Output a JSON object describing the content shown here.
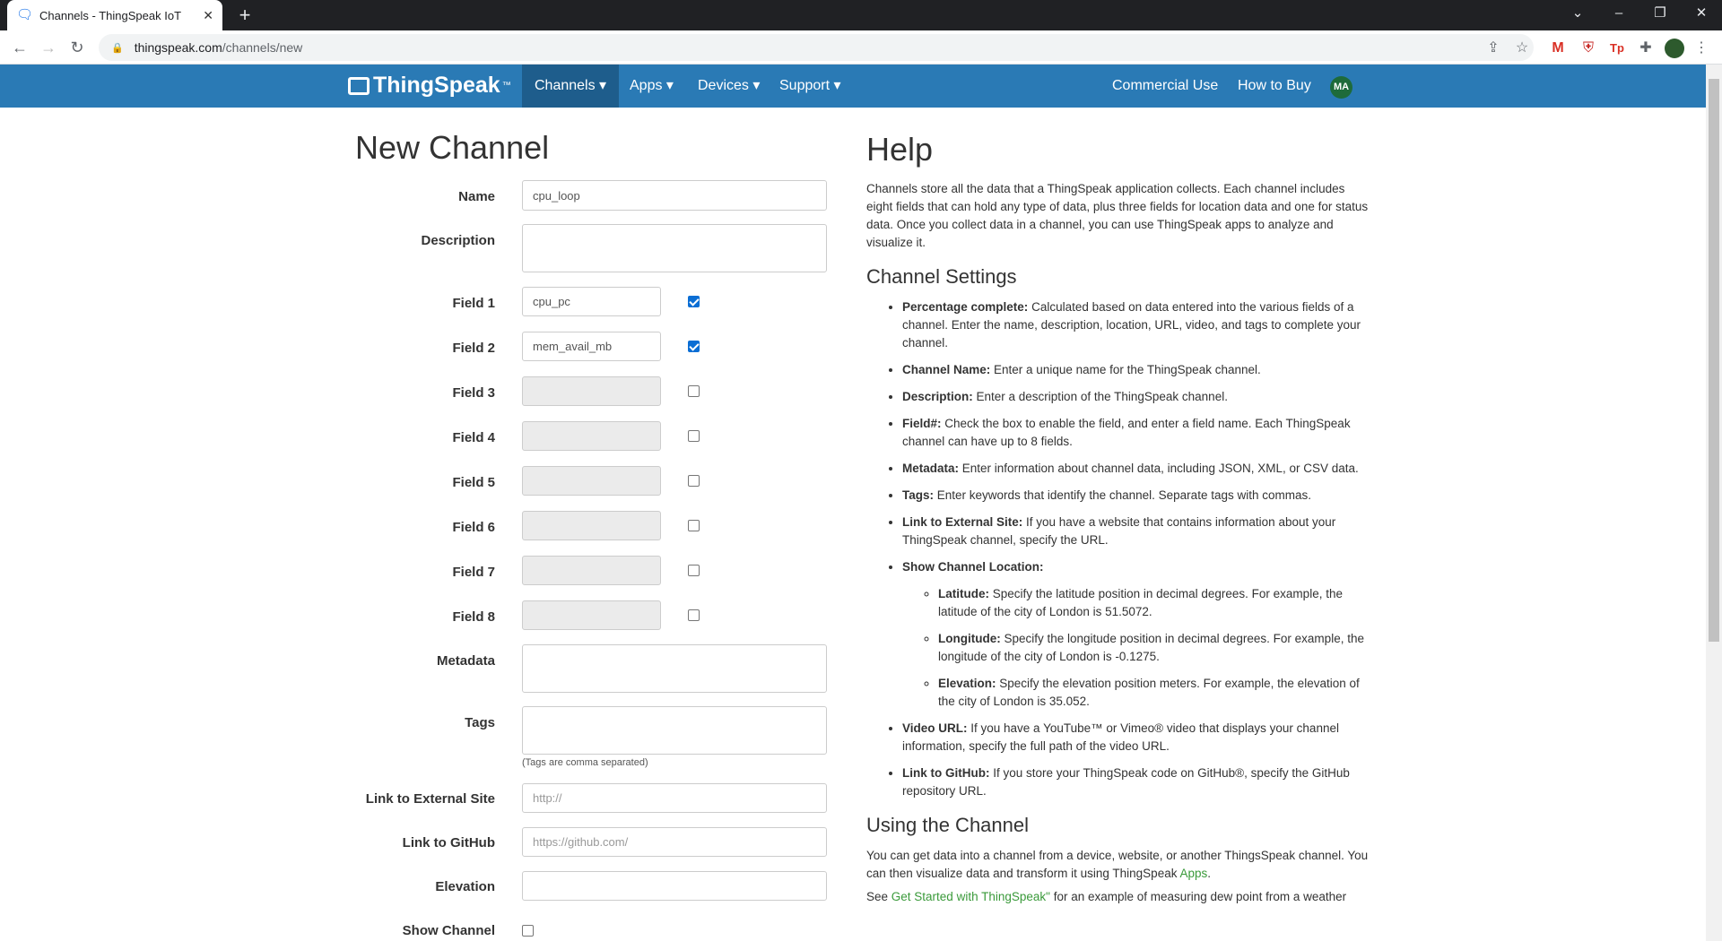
{
  "browser": {
    "tab_title": "Channels - ThingSpeak IoT",
    "url_host": "thingspeak.com",
    "url_path": "/channels/new"
  },
  "nav": {
    "logo": "ThingSpeak",
    "logo_tm": "™",
    "channels": "Channels ▾",
    "apps": "Apps ▾",
    "devices": "Devices ▾",
    "support": "Support ▾",
    "commercial": "Commercial Use",
    "how_to_buy": "How to Buy",
    "avatar": "MA"
  },
  "form": {
    "title": "New Channel",
    "name_label": "Name",
    "name_value": "cpu_loop",
    "description_label": "Description",
    "fields": [
      {
        "label": "Field 1",
        "value": "cpu_pc",
        "checked": true
      },
      {
        "label": "Field 2",
        "value": "mem_avail_mb",
        "checked": true
      },
      {
        "label": "Field 3",
        "value": "",
        "checked": false
      },
      {
        "label": "Field 4",
        "value": "",
        "checked": false
      },
      {
        "label": "Field 5",
        "value": "",
        "checked": false
      },
      {
        "label": "Field 6",
        "value": "",
        "checked": false
      },
      {
        "label": "Field 7",
        "value": "",
        "checked": false
      },
      {
        "label": "Field 8",
        "value": "",
        "checked": false
      }
    ],
    "metadata_label": "Metadata",
    "tags_label": "Tags",
    "tags_hint": "(Tags are comma separated)",
    "link_external_label": "Link to External Site",
    "link_external_placeholder": "http://",
    "link_github_label": "Link to GitHub",
    "link_github_placeholder": "https://github.com/",
    "elevation_label": "Elevation",
    "show_channel_label": "Show Channel"
  },
  "help": {
    "title": "Help",
    "intro": "Channels store all the data that a ThingSpeak application collects. Each channel includes eight fields that can hold any type of data, plus three fields for location data and one for status data. Once you collect data in a channel, you can use ThingSpeak apps to analyze and visualize it.",
    "settings_title": "Channel Settings",
    "items": [
      {
        "term": "Percentage complete:",
        "text": " Calculated based on data entered into the various fields of a channel. Enter the name, description, location, URL, video, and tags to complete your channel."
      },
      {
        "term": "Channel Name:",
        "text": " Enter a unique name for the ThingSpeak channel."
      },
      {
        "term": "Description:",
        "text": " Enter a description of the ThingSpeak channel."
      },
      {
        "term": "Field#:",
        "text": " Check the box to enable the field, and enter a field name. Each ThingSpeak channel can have up to 8 fields."
      },
      {
        "term": "Metadata:",
        "text": " Enter information about channel data, including JSON, XML, or CSV data."
      },
      {
        "term": "Tags:",
        "text": " Enter keywords that identify the channel. Separate tags with commas."
      },
      {
        "term": "Link to External Site:",
        "text": " If you have a website that contains information about your ThingSpeak channel, specify the URL."
      },
      {
        "term": "Show Channel Location:",
        "text": ""
      }
    ],
    "location_items": [
      {
        "term": "Latitude:",
        "text": " Specify the latitude position in decimal degrees. For example, the latitude of the city of London is 51.5072."
      },
      {
        "term": "Longitude:",
        "text": " Specify the longitude position in decimal degrees. For example, the longitude of the city of London is -0.1275."
      },
      {
        "term": "Elevation:",
        "text": " Specify the elevation position meters. For example, the elevation of the city of London is 35.052."
      }
    ],
    "items2": [
      {
        "term": "Video URL:",
        "text": " If you have a YouTube™ or Vimeo® video that displays your channel information, specify the full path of the video URL."
      },
      {
        "term": "Link to GitHub:",
        "text": " If you store your ThingSpeak code on GitHub®, specify the GitHub repository URL."
      }
    ],
    "using_title": "Using the Channel",
    "using_text": "You can get data into a channel from a device, website, or another ThingsSpeak channel. You can then visualize data and transform it using ThingSpeak ",
    "using_link": "Apps",
    "using_end": ".",
    "see_text": "See ",
    "see_link": "Get Started with ThingSpeak\"",
    "see_end": " for an example of measuring dew point from a weather"
  }
}
